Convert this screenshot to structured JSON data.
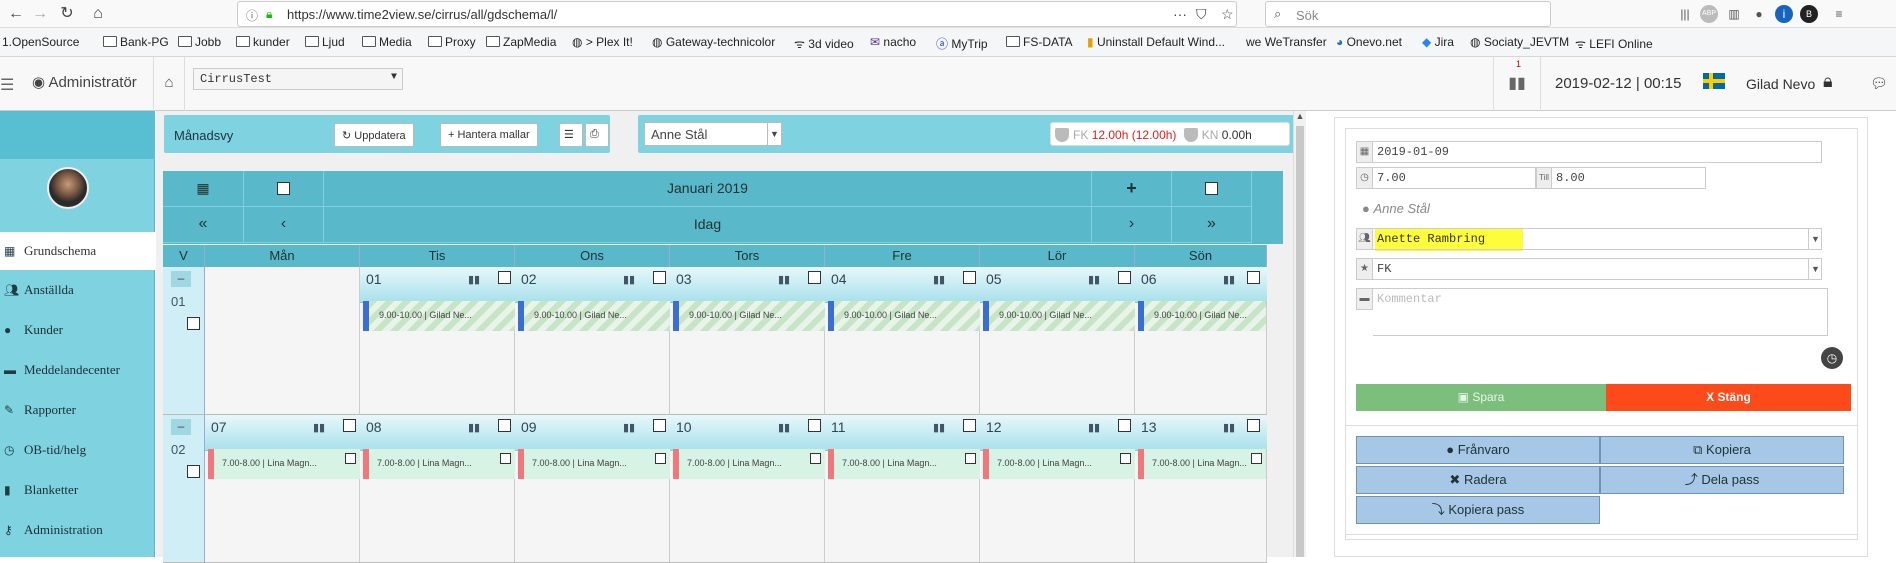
{
  "browser": {
    "url": "https://www.time2view.se/cirrus/all/gdschema/l/",
    "search_placeholder": "Sök",
    "bookmarks": [
      "1.OpenSource",
      "Bank-PG",
      "Jobb",
      "kunder",
      "Ljud",
      "Media",
      "Proxy",
      "ZapMedia",
      "> Plex It!",
      "Gateway-technicolor",
      "3d video",
      "nacho",
      "MyTrip",
      "FS-DATA",
      "Uninstall Default Wind...",
      "WeTransfer",
      "Onevo.net",
      "Jira",
      "Sociaty_JEVTM",
      "LEFI Online"
    ]
  },
  "header": {
    "brand": "Administratör",
    "tenant": "CirrusTest",
    "notif_count": "1",
    "datetime": "2019-02-12 | 00:15",
    "user": "Gilad Nevo"
  },
  "sidebar": {
    "items": [
      {
        "label": "Grundschema",
        "icon": "calendar-icon"
      },
      {
        "label": "Anställda",
        "icon": "users-icon"
      },
      {
        "label": "Kunder",
        "icon": "user-icon"
      },
      {
        "label": "Meddelandecenter",
        "icon": "message-icon"
      },
      {
        "label": "Rapporter",
        "icon": "pencil-icon"
      },
      {
        "label": "OB-tid/helg",
        "icon": "clock-icon"
      },
      {
        "label": "Blanketter",
        "icon": "bookmark-icon"
      },
      {
        "label": "Administration",
        "icon": "key-icon"
      }
    ]
  },
  "toolbar": {
    "view_label": "Månadsvy",
    "refresh": "Uppdatera",
    "templates": "Hantera mallar",
    "person": "Anne Stål",
    "fk_label": "FK",
    "fk_hours": "12.00h (12.00h)",
    "kn_label": "KN",
    "kn_hours": "0.00h"
  },
  "calendar": {
    "month": "Januari 2019",
    "today": "Idag",
    "week_col": "V",
    "days": [
      "Mån",
      "Tis",
      "Ons",
      "Tors",
      "Fre",
      "Lör",
      "Sön"
    ],
    "weeks": [
      {
        "num": "01",
        "dates": [
          "",
          "01",
          "02",
          "03",
          "04",
          "05",
          "06"
        ],
        "shift": "9.00-10.00 | Gilad Ne...",
        "shift_type": "fk"
      },
      {
        "num": "02",
        "dates": [
          "07",
          "08",
          "09",
          "10",
          "11",
          "12",
          "13"
        ],
        "shift": "7.00-8.00 | Lina Magn...",
        "shift_type": "lina"
      }
    ]
  },
  "form": {
    "date": "2019-01-09",
    "from": "7.00",
    "till_label": "Till",
    "to": "8.00",
    "employee": "Anne Stål",
    "substitute": "Anette Rambring",
    "type": "FK",
    "comment_placeholder": "Kommentar",
    "save": "Spara",
    "close": "X Stäng"
  },
  "actions": {
    "absence": "Frånvaro",
    "copy": "Kopiera",
    "delete": "Radera",
    "split": "Dela pass",
    "copy_shift": "Kopiera pass"
  }
}
